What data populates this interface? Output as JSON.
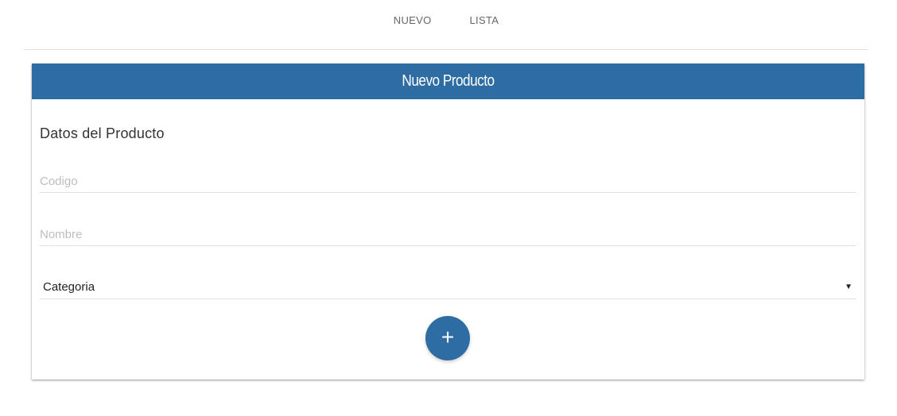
{
  "nav": {
    "items": [
      {
        "label": "NUEVO"
      },
      {
        "label": "LISTA"
      }
    ]
  },
  "card": {
    "header_title": "Nuevo Producto",
    "section_title": "Datos del Producto",
    "fields": {
      "codigo_placeholder": "Codigo",
      "nombre_placeholder": "Nombre",
      "categoria_value": "Categoria"
    },
    "add_button_icon": "plus-icon",
    "add_button_glyph": "+"
  },
  "colors": {
    "primary": "#2e6da4",
    "placeholder": "#bdbdbd",
    "divider": "#e0e0e0"
  }
}
